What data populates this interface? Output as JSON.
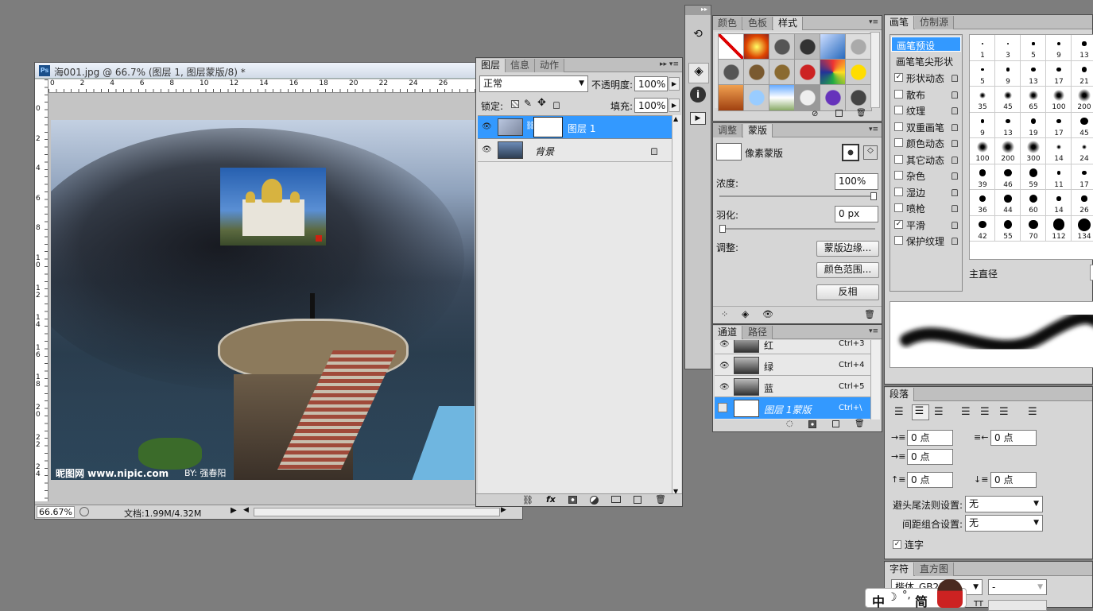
{
  "document": {
    "title": "海001.jpg @ 66.7% (图层 1, 图层蒙版/8) *",
    "ps_icon": "Ps",
    "ruler_h": [
      "0",
      "2",
      "4",
      "6",
      "8",
      "10",
      "12",
      "14",
      "16",
      "18",
      "20",
      "22",
      "24",
      "26"
    ],
    "ruler_v": [
      "0",
      "2",
      "4",
      "6",
      "8",
      "10",
      "12",
      "14",
      "16",
      "18",
      "20",
      "22",
      "24"
    ],
    "watermark": "昵图网 www.nipic.com",
    "watermark_by": "BY: 强春阳",
    "zoom": "66.67%",
    "doc_info": "文档:1.99M/4.32M"
  },
  "layers_panel": {
    "tabs": [
      "图层",
      "信息",
      "动作"
    ],
    "blend_mode": "正常",
    "opacity_label": "不透明度:",
    "opacity_value": "100%",
    "lock_label": "锁定:",
    "fill_label": "填充:",
    "fill_value": "100%",
    "layers": [
      {
        "name": "图层 1",
        "selected": true
      },
      {
        "name": "背景",
        "selected": false
      }
    ]
  },
  "styles_panel": {
    "tabs": [
      "颜色",
      "色板",
      "样式"
    ]
  },
  "masks_panel": {
    "tabs": [
      "调整",
      "蒙版"
    ],
    "pixel_mask": "像素蒙版",
    "density_label": "浓度:",
    "density_value": "100%",
    "feather_label": "羽化:",
    "feather_value": "0 px",
    "adjust_label": "调整:",
    "btn_edge": "蒙版边缘...",
    "btn_color_range": "颜色范围...",
    "btn_invert": "反相"
  },
  "channels_panel": {
    "tabs": [
      "通道",
      "路径"
    ],
    "channels": [
      {
        "name": "红",
        "shortcut": "Ctrl+3"
      },
      {
        "name": "绿",
        "shortcut": "Ctrl+4"
      },
      {
        "name": "蓝",
        "shortcut": "Ctrl+5"
      },
      {
        "name": "图层 1蒙版",
        "shortcut": "Ctrl+\\"
      }
    ]
  },
  "brush_panel": {
    "tabs": [
      "画笔",
      "仿制源"
    ],
    "options": [
      {
        "label": "画笔预设",
        "checkbox": false,
        "checked": false,
        "selected": true
      },
      {
        "label": "画笔笔尖形状",
        "checkbox": false,
        "checked": false,
        "selected": false
      },
      {
        "label": "形状动态",
        "checkbox": true,
        "checked": true,
        "selected": false
      },
      {
        "label": "散布",
        "checkbox": true,
        "checked": false,
        "selected": false
      },
      {
        "label": "纹理",
        "checkbox": true,
        "checked": false,
        "selected": false
      },
      {
        "label": "双重画笔",
        "checkbox": true,
        "checked": false,
        "selected": false
      },
      {
        "label": "颜色动态",
        "checkbox": true,
        "checked": false,
        "selected": false
      },
      {
        "label": "其它动态",
        "checkbox": true,
        "checked": false,
        "selected": false
      },
      {
        "label": "杂色",
        "checkbox": true,
        "checked": false,
        "selected": false
      },
      {
        "label": "湿边",
        "checkbox": true,
        "checked": false,
        "selected": false
      },
      {
        "label": "喷枪",
        "checkbox": true,
        "checked": false,
        "selected": false
      },
      {
        "label": "平滑",
        "checkbox": true,
        "checked": true,
        "selected": false
      },
      {
        "label": "保护纹理",
        "checkbox": true,
        "checked": false,
        "selected": false
      }
    ],
    "sizes": [
      "1",
      "3",
      "5",
      "9",
      "13",
      "5",
      "9",
      "13",
      "17",
      "21",
      "35",
      "45",
      "65",
      "100",
      "200",
      "9",
      "13",
      "19",
      "17",
      "45",
      "100",
      "200",
      "300",
      "14",
      "24",
      "39",
      "46",
      "59",
      "11",
      "17",
      "36",
      "44",
      "60",
      "14",
      "26",
      "42",
      "55",
      "70",
      "112",
      "134"
    ],
    "master_diameter_label": "主直径"
  },
  "paragraph_panel": {
    "tabs": [
      "段落"
    ],
    "indent_left": "0 点",
    "indent_right": "0 点",
    "indent_first": "0 点",
    "space_before": "0 点",
    "space_after": "0 点",
    "kinsoku_label": "避头尾法则设置:",
    "kinsoku_value": "无",
    "mojikumi_label": "间距组合设置:",
    "mojikumi_value": "无",
    "hyphen_label": "连字"
  },
  "character_panel": {
    "tabs": [
      "字符",
      "直方图"
    ],
    "font": "楷体_GB2312",
    "style": "-"
  },
  "ime": {
    "label": "中",
    "mode": "简"
  },
  "colors": {
    "selection": "#3399ff",
    "panel_bg": "#d6d6d6"
  }
}
